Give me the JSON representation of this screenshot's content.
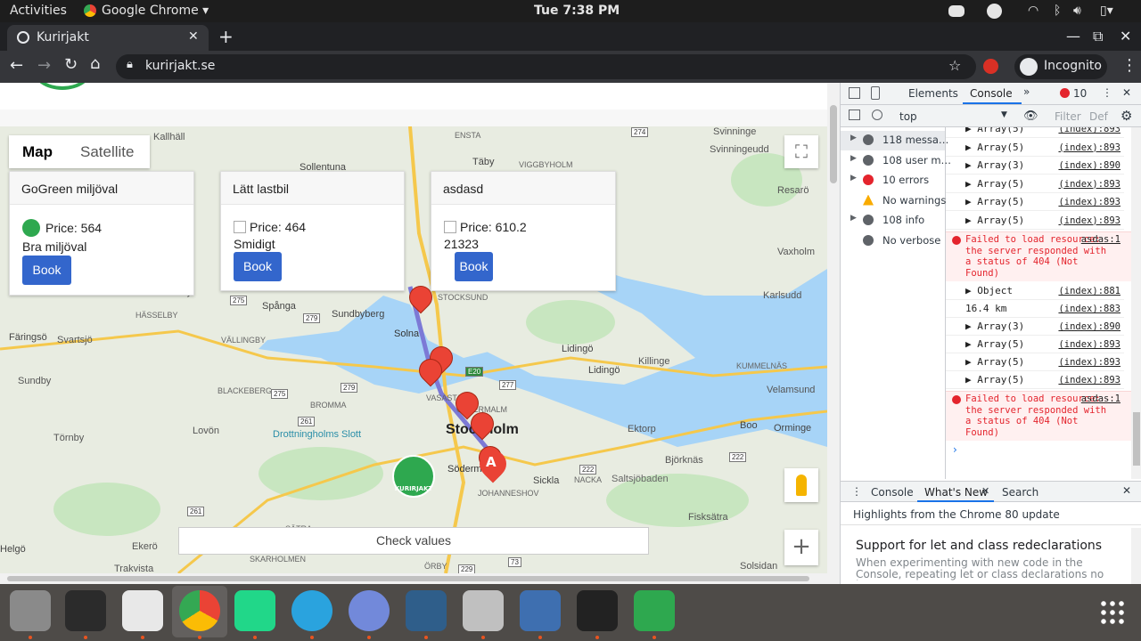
{
  "system": {
    "activities": "Activities",
    "app": "Google Chrome",
    "clock": "Tue  7:38 PM"
  },
  "browser": {
    "tab_title": "Kurirjakt",
    "url": "kurirjakt.se",
    "incognito": "Incognito"
  },
  "map": {
    "type_map": "Map",
    "type_satellite": "Satellite",
    "check_values": "Check values",
    "labels": [
      {
        "t": "Kallhäll",
        "c": "#555"
      },
      {
        "t": "ENSTA",
        "c": "#666"
      },
      {
        "t": "Täby",
        "c": "#444"
      },
      {
        "t": "Svinninge",
        "c": "#555"
      },
      {
        "t": "Svinningeudd",
        "c": "#555"
      },
      {
        "t": "Sollentuna",
        "c": "#444"
      },
      {
        "t": "VIGGBYHOLM",
        "c": "#666"
      },
      {
        "t": "Resarö",
        "c": "#555"
      },
      {
        "t": "Hässelby",
        "c": "#444"
      },
      {
        "t": "HÄSSELBY",
        "c": "#666"
      },
      {
        "t": "Spånga",
        "c": "#444"
      },
      {
        "t": "STOCKSUND",
        "c": "#666"
      },
      {
        "t": "Karlsudd",
        "c": "#555"
      },
      {
        "t": "Vaxholm",
        "c": "#555"
      },
      {
        "t": "Färingsö",
        "c": "#444"
      },
      {
        "t": "Svartsjö",
        "c": "#555"
      },
      {
        "t": "VÄLLINGBY",
        "c": "#666"
      },
      {
        "t": "Sundbyberg",
        "c": "#444"
      },
      {
        "t": "Solna",
        "c": "#333"
      },
      {
        "t": "Lidingö",
        "c": "#444"
      },
      {
        "t": "Lidingö",
        "c": "#444"
      },
      {
        "t": "Killinge",
        "c": "#555"
      },
      {
        "t": "KUMMELNÄS",
        "c": "#666"
      },
      {
        "t": "Sundby",
        "c": "#555"
      },
      {
        "t": "BLACKEBERG",
        "c": "#666"
      },
      {
        "t": "VASASTAN",
        "c": "#666"
      },
      {
        "t": "ÖSTERMALM",
        "c": "#666"
      },
      {
        "t": "Velamsund",
        "c": "#555"
      },
      {
        "t": "BROMMA",
        "c": "#666"
      },
      {
        "t": "Stockholm",
        "c": "#222"
      },
      {
        "t": "Boo",
        "c": "#444"
      },
      {
        "t": "Orminge",
        "c": "#444"
      },
      {
        "t": "Törnby",
        "c": "#555"
      },
      {
        "t": "Lovön",
        "c": "#555"
      },
      {
        "t": "Drottningholms Slott",
        "c": "#2a8ea8"
      },
      {
        "t": "Södermalm",
        "c": "#333"
      },
      {
        "t": "Ektorp",
        "c": "#555"
      },
      {
        "t": "Björknäs",
        "c": "#555"
      },
      {
        "t": "Sickla",
        "c": "#444"
      },
      {
        "t": "NACKA",
        "c": "#666"
      },
      {
        "t": "JOHANNESHOV",
        "c": "#666"
      },
      {
        "t": "Saltsjöbaden",
        "c": "#666"
      },
      {
        "t": "Fisksätra",
        "c": "#555"
      },
      {
        "t": "Helgö",
        "c": "#444"
      },
      {
        "t": "Ekerö",
        "c": "#555"
      },
      {
        "t": "SKARHOLMEN",
        "c": "#666"
      },
      {
        "t": "SÄTRA",
        "c": "#666"
      },
      {
        "t": "ÖRBY",
        "c": "#666"
      },
      {
        "t": "Trakvista",
        "c": "#555"
      },
      {
        "t": "Solsidan",
        "c": "#555"
      }
    ],
    "road_numbers": [
      "274",
      "275",
      "279",
      "275",
      "279",
      "277",
      "E20",
      "261",
      "222",
      "222",
      "261",
      "229",
      "73"
    ],
    "cards": [
      {
        "title": "GoGreen miljöval",
        "price": "Price: 564",
        "desc": "Bra miljöval",
        "book": "Book"
      },
      {
        "title": "Lätt lastbil",
        "price": "Price: 464",
        "desc": "Smidigt",
        "book": "Book"
      },
      {
        "title": "asdasd",
        "price": "Price: 610.2",
        "desc": "21323",
        "book": "Book"
      }
    ],
    "marker_a": "A",
    "logo_text": "KURIRJAKT"
  },
  "devtools": {
    "tabs": [
      "Elements",
      "Console"
    ],
    "errors_badge": "10",
    "context": "top",
    "filter_placeholder": "Filter",
    "levels": "Def",
    "sidebar": [
      {
        "label": "118 messa…",
        "icon": "list-icon"
      },
      {
        "label": "108 user m…",
        "icon": "user-icon"
      },
      {
        "label": "10 errors",
        "icon": "error-icon"
      },
      {
        "label": "No warnings",
        "icon": "warning-icon"
      },
      {
        "label": "108 info",
        "icon": "info-icon"
      },
      {
        "label": "No verbose",
        "icon": "verbose-icon"
      }
    ],
    "log": [
      {
        "text": "▶ Array(5)",
        "src": "(index):893"
      },
      {
        "text": "▶ Array(5)",
        "src": "(index):893"
      },
      {
        "text": "▶ Array(3)",
        "src": "(index):890"
      },
      {
        "text": "▶ Array(5)",
        "src": "(index):893"
      },
      {
        "text": "▶ Array(5)",
        "src": "(index):893"
      },
      {
        "text": "▶ Array(5)",
        "src": "(index):893"
      }
    ],
    "error1": {
      "text": "Failed to load resource: the server responded with a status of 404 (Not Found)",
      "src": "asdas:1"
    },
    "log2": [
      {
        "text": "▶ Object",
        "src": "(index):881"
      },
      {
        "text": "16.4 km",
        "src": "(index):883"
      },
      {
        "text": "▶ Array(3)",
        "src": "(index):890"
      },
      {
        "text": "▶ Array(5)",
        "src": "(index):893"
      },
      {
        "text": "▶ Array(5)",
        "src": "(index):893"
      },
      {
        "text": "▶ Array(5)",
        "src": "(index):893"
      }
    ],
    "error2": {
      "text": "Failed to load resource: the server responded with a status of 404 (Not Found)",
      "src": "asdas:1"
    },
    "drawer_tabs": [
      "Console",
      "What's New",
      "Search"
    ],
    "highlights": "Highlights from the Chrome 80 update",
    "feature_title": "Support for let and class redeclarations",
    "feature_desc": "When experimenting with new code in the Console, repeating let or class declarations no longer causes errors."
  },
  "dock": [
    {
      "name": "files-icon",
      "color": "#8a8a8a"
    },
    {
      "name": "terminal-icon",
      "color": "#2b2b2b"
    },
    {
      "name": "text-editor-icon",
      "color": "#e8e8e8"
    },
    {
      "name": "chrome-icon",
      "color": "#ffffff"
    },
    {
      "name": "pycharm-icon",
      "color": "#21d789"
    },
    {
      "name": "telegram-icon",
      "color": "#2aa3de"
    },
    {
      "name": "discord-icon",
      "color": "#7289da"
    },
    {
      "name": "mysql-workbench-icon",
      "color": "#2f5e8a"
    },
    {
      "name": "settings-icon",
      "color": "#c0c0c0"
    },
    {
      "name": "vpn-icon",
      "color": "#3e6fb0"
    },
    {
      "name": "system-monitor-icon",
      "color": "#222"
    },
    {
      "name": "kurirjakt-app-icon",
      "color": "#2ea84f"
    }
  ]
}
